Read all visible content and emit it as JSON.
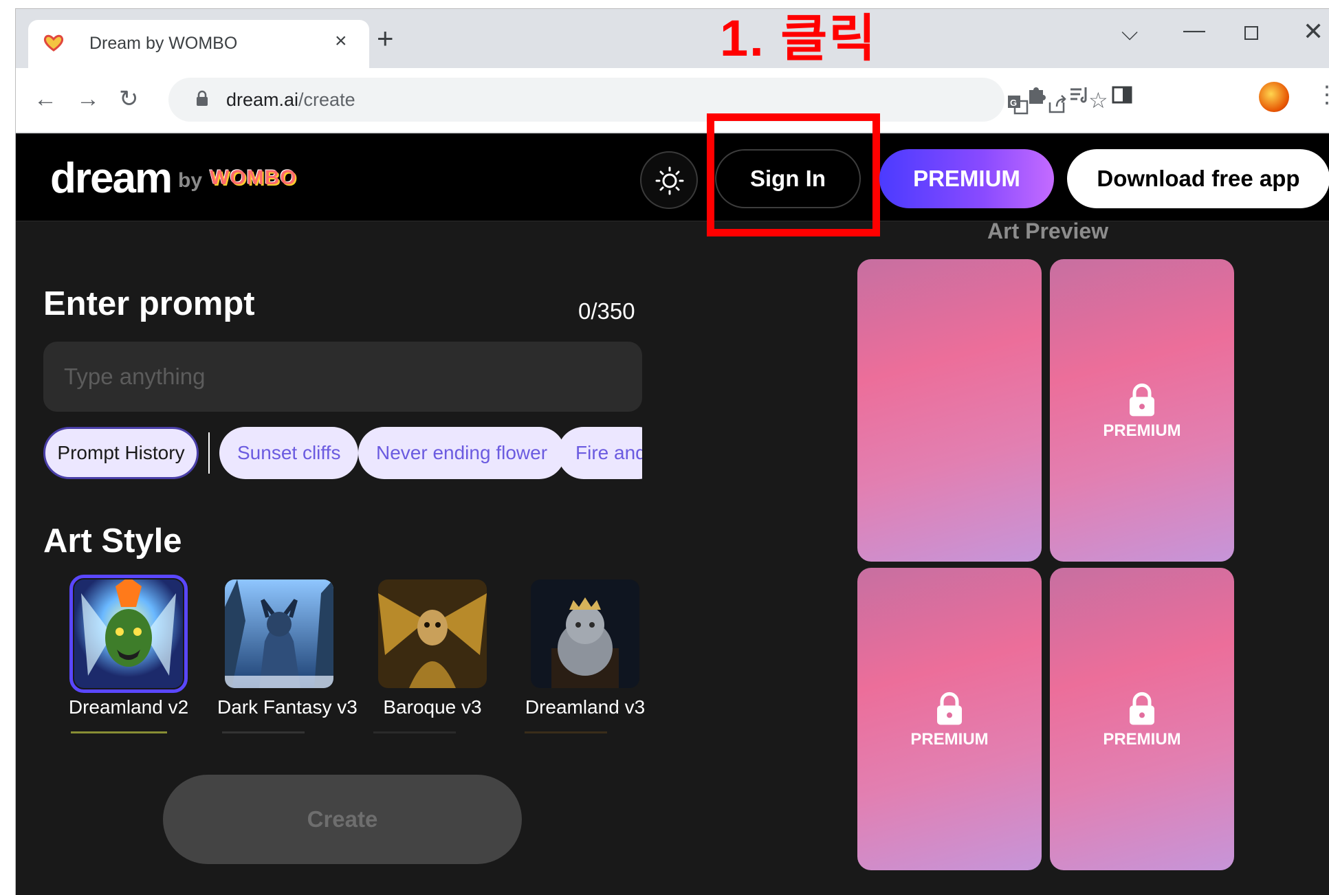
{
  "browser": {
    "tab_title": "Dream by WOMBO",
    "url_host": "dream.ai",
    "url_path": "/create"
  },
  "annotation": {
    "text": "1. 클릭"
  },
  "header": {
    "logo_word": "dream",
    "logo_by": "by",
    "logo_brand": "WOMBO",
    "signin_label": "Sign In",
    "premium_label": "PREMIUM",
    "download_label": "Download free app"
  },
  "prompt": {
    "title": "Enter prompt",
    "count": "0/350",
    "placeholder": "Type anything",
    "history_label": "Prompt History",
    "suggestions": [
      "Sunset cliffs",
      "Never ending flower",
      "Fire and"
    ]
  },
  "art_style": {
    "title": "Art Style",
    "styles": [
      {
        "label": "Dreamland v2",
        "selected": true
      },
      {
        "label": "Dark Fantasy v3",
        "selected": false
      },
      {
        "label": "Baroque v3",
        "selected": false
      },
      {
        "label": "Dreamland v3",
        "selected": false
      }
    ]
  },
  "create": {
    "label": "Create"
  },
  "preview": {
    "title": "Art Preview",
    "cards": [
      {
        "label": "",
        "locked": false
      },
      {
        "label": "PREMIUM",
        "locked": true
      },
      {
        "label": "PREMIUM",
        "locked": true
      },
      {
        "label": "PREMIUM",
        "locked": true
      }
    ]
  },
  "colors": {
    "accent": "#5a47ff",
    "highlight_box": "#ff0000",
    "page_bg": "#191919"
  }
}
